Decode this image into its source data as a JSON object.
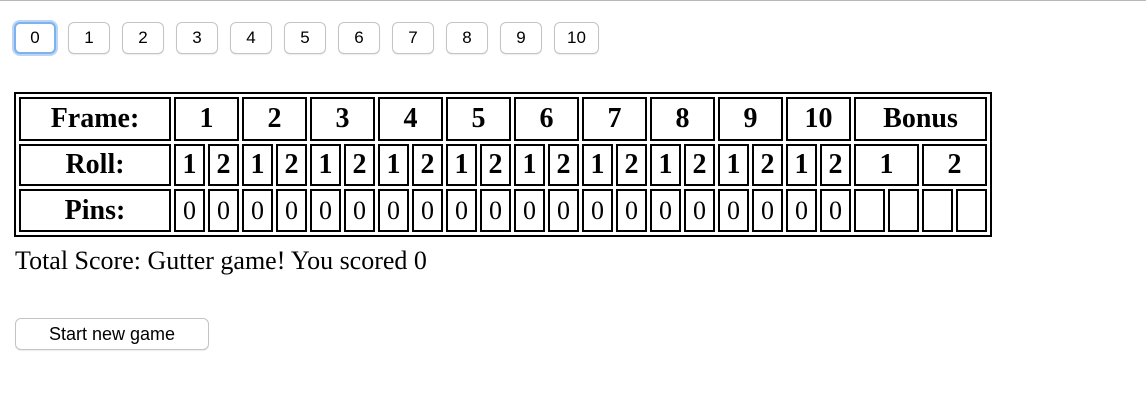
{
  "pin_buttons": [
    "0",
    "1",
    "2",
    "3",
    "4",
    "5",
    "6",
    "7",
    "8",
    "9",
    "10"
  ],
  "focused_button": "0",
  "scorecard": {
    "frame_label": "Frame:",
    "roll_label": "Roll:",
    "pins_label": "Pins:",
    "frames": [
      "1",
      "2",
      "3",
      "4",
      "5",
      "6",
      "7",
      "8",
      "9",
      "10"
    ],
    "bonus_label": "Bonus",
    "roll_numbers": [
      "1",
      "2"
    ],
    "bonus_rolls": [
      "1",
      "2"
    ],
    "pins": [
      [
        "0",
        "0"
      ],
      [
        "0",
        "0"
      ],
      [
        "0",
        "0"
      ],
      [
        "0",
        "0"
      ],
      [
        "0",
        "0"
      ],
      [
        "0",
        "0"
      ],
      [
        "0",
        "0"
      ],
      [
        "0",
        "0"
      ],
      [
        "0",
        "0"
      ],
      [
        "0",
        "0"
      ]
    ],
    "bonus_pins": [
      [
        "",
        ""
      ],
      [
        "",
        ""
      ]
    ]
  },
  "total_score_text": "Total Score: Gutter game! You scored 0",
  "new_game_label": "Start new game",
  "colors": {
    "focus_ring": "#7db3ea",
    "button_border": "#c4c4c4",
    "table_border": "#000000"
  }
}
